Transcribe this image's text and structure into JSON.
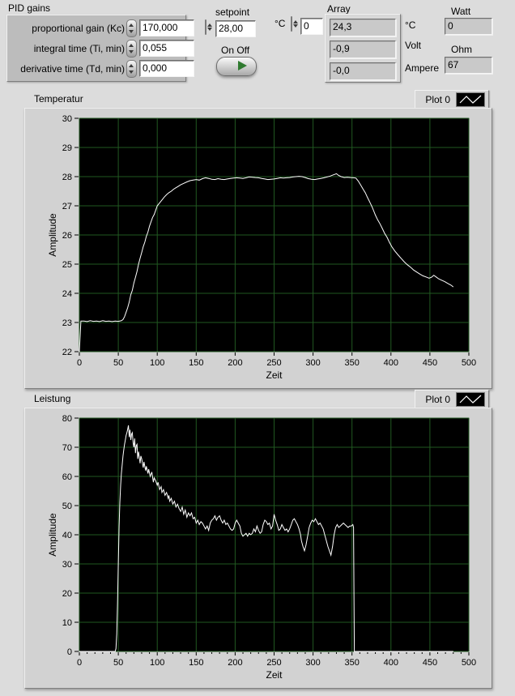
{
  "panel": {
    "pid": {
      "group_label": "PID gains",
      "rows": [
        {
          "label": "proportional gain (Kc)",
          "value": "170,000"
        },
        {
          "label": "integral time (Ti, min)",
          "value": "0,055"
        },
        {
          "label": "derivative time (Td, min)",
          "value": "0,000"
        }
      ]
    },
    "setpoint": {
      "label": "setpoint",
      "value": "28,00"
    },
    "onoff_label": "On Off",
    "celsius_control": {
      "label": "°C",
      "value": "0"
    },
    "array": {
      "label": "Array",
      "values": [
        "24,3",
        "-0,9",
        "-0,0"
      ]
    },
    "unit_labels": {
      "c": "°C",
      "volt": "Volt",
      "ampere": "Ampere"
    },
    "watt": {
      "label": "Watt",
      "value": "0"
    },
    "ohm": {
      "label": "Ohm",
      "value": "67"
    }
  },
  "chart_data": [
    {
      "type": "line",
      "title": "Temperatur",
      "legend": "Plot 0",
      "xlabel": "Zeit",
      "ylabel": "Amplitude",
      "xlim": [
        0,
        500
      ],
      "ylim": [
        22,
        30
      ],
      "xticks": [
        0,
        50,
        100,
        150,
        200,
        250,
        300,
        350,
        400,
        450,
        500
      ],
      "yticks": [
        22,
        23,
        24,
        25,
        26,
        27,
        28,
        29,
        30
      ],
      "x_minor_step": null,
      "grid": true,
      "legend_position": "top-right",
      "bg_color": "#000000",
      "grid_color": "#215821",
      "line_color": "#ffffff",
      "points": [
        [
          0,
          22.0
        ],
        [
          2,
          23.05
        ],
        [
          6,
          23.05
        ],
        [
          10,
          23.03
        ],
        [
          14,
          23.06
        ],
        [
          18,
          23.04
        ],
        [
          22,
          23.05
        ],
        [
          26,
          23.03
        ],
        [
          30,
          23.06
        ],
        [
          34,
          23.04
        ],
        [
          38,
          23.05
        ],
        [
          42,
          23.03
        ],
        [
          46,
          23.05
        ],
        [
          50,
          23.04
        ],
        [
          54,
          23.06
        ],
        [
          56,
          23.1
        ],
        [
          58,
          23.2
        ],
        [
          60,
          23.35
        ],
        [
          62,
          23.5
        ],
        [
          64,
          23.7
        ],
        [
          66,
          23.95
        ],
        [
          68,
          24.1
        ],
        [
          70,
          24.35
        ],
        [
          72,
          24.55
        ],
        [
          74,
          24.75
        ],
        [
          76,
          25.0
        ],
        [
          78,
          25.2
        ],
        [
          80,
          25.4
        ],
        [
          82,
          25.6
        ],
        [
          84,
          25.75
        ],
        [
          86,
          25.95
        ],
        [
          88,
          26.1
        ],
        [
          90,
          26.3
        ],
        [
          92,
          26.45
        ],
        [
          94,
          26.6
        ],
        [
          96,
          26.7
        ],
        [
          98,
          26.85
        ],
        [
          100,
          27.0
        ],
        [
          103,
          27.1
        ],
        [
          106,
          27.2
        ],
        [
          109,
          27.3
        ],
        [
          112,
          27.38
        ],
        [
          115,
          27.45
        ],
        [
          118,
          27.5
        ],
        [
          121,
          27.57
        ],
        [
          124,
          27.62
        ],
        [
          127,
          27.67
        ],
        [
          130,
          27.72
        ],
        [
          134,
          27.77
        ],
        [
          138,
          27.82
        ],
        [
          142,
          27.86
        ],
        [
          146,
          27.88
        ],
        [
          150,
          27.9
        ],
        [
          154,
          27.88
        ],
        [
          158,
          27.93
        ],
        [
          162,
          27.96
        ],
        [
          166,
          27.94
        ],
        [
          170,
          27.91
        ],
        [
          174,
          27.9
        ],
        [
          178,
          27.93
        ],
        [
          182,
          27.91
        ],
        [
          186,
          27.9
        ],
        [
          190,
          27.92
        ],
        [
          194,
          27.94
        ],
        [
          198,
          27.95
        ],
        [
          202,
          27.96
        ],
        [
          206,
          27.95
        ],
        [
          210,
          27.94
        ],
        [
          214,
          27.96
        ],
        [
          218,
          27.99
        ],
        [
          222,
          27.98
        ],
        [
          226,
          27.97
        ],
        [
          230,
          27.96
        ],
        [
          234,
          27.94
        ],
        [
          238,
          27.92
        ],
        [
          242,
          27.9
        ],
        [
          246,
          27.91
        ],
        [
          250,
          27.92
        ],
        [
          254,
          27.94
        ],
        [
          258,
          27.96
        ],
        [
          262,
          27.95
        ],
        [
          266,
          27.96
        ],
        [
          270,
          27.97
        ],
        [
          274,
          27.99
        ],
        [
          278,
          28.0
        ],
        [
          282,
          28.01
        ],
        [
          286,
          28.0
        ],
        [
          290,
          27.97
        ],
        [
          294,
          27.93
        ],
        [
          298,
          27.91
        ],
        [
          302,
          27.9
        ],
        [
          306,
          27.92
        ],
        [
          310,
          27.94
        ],
        [
          314,
          27.96
        ],
        [
          318,
          27.99
        ],
        [
          322,
          28.02
        ],
        [
          326,
          28.06
        ],
        [
          330,
          28.1
        ],
        [
          333,
          28.04
        ],
        [
          336,
          28.0
        ],
        [
          340,
          27.97
        ],
        [
          344,
          27.98
        ],
        [
          348,
          27.97
        ],
        [
          352,
          27.96
        ],
        [
          355,
          27.95
        ],
        [
          358,
          27.85
        ],
        [
          361,
          27.72
        ],
        [
          364,
          27.58
        ],
        [
          367,
          27.45
        ],
        [
          370,
          27.28
        ],
        [
          373,
          27.12
        ],
        [
          376,
          26.95
        ],
        [
          378,
          26.82
        ],
        [
          380,
          26.68
        ],
        [
          383,
          26.52
        ],
        [
          386,
          26.38
        ],
        [
          389,
          26.22
        ],
        [
          392,
          26.05
        ],
        [
          395,
          25.92
        ],
        [
          398,
          25.75
        ],
        [
          401,
          25.6
        ],
        [
          405,
          25.45
        ],
        [
          409,
          25.32
        ],
        [
          413,
          25.2
        ],
        [
          417,
          25.08
        ],
        [
          421,
          24.98
        ],
        [
          425,
          24.9
        ],
        [
          429,
          24.8
        ],
        [
          433,
          24.73
        ],
        [
          437,
          24.66
        ],
        [
          441,
          24.6
        ],
        [
          445,
          24.56
        ],
        [
          449,
          24.52
        ],
        [
          452,
          24.55
        ],
        [
          455,
          24.62
        ],
        [
          458,
          24.56
        ],
        [
          461,
          24.5
        ],
        [
          465,
          24.45
        ],
        [
          469,
          24.4
        ],
        [
          473,
          24.34
        ],
        [
          477,
          24.28
        ],
        [
          480,
          24.22
        ]
      ]
    },
    {
      "type": "line",
      "title": "Leistung",
      "legend": "Plot 0",
      "xlabel": "Zeit",
      "ylabel": "Amplitude",
      "xlim": [
        0,
        500
      ],
      "ylim": [
        0,
        80
      ],
      "xticks": [
        0,
        50,
        100,
        150,
        200,
        250,
        300,
        350,
        400,
        450,
        500
      ],
      "yticks": [
        0,
        10,
        20,
        30,
        40,
        50,
        60,
        70,
        80
      ],
      "x_minor_step": 10,
      "grid": true,
      "legend_position": "top-right",
      "bg_color": "#000000",
      "grid_color": "#215821",
      "line_color": "#ffffff",
      "points": [
        [
          0,
          0
        ],
        [
          46,
          0
        ],
        [
          47,
          1
        ],
        [
          48,
          6
        ],
        [
          49,
          16
        ],
        [
          50,
          30
        ],
        [
          51,
          43
        ],
        [
          52,
          51
        ],
        [
          53,
          57
        ],
        [
          54,
          61
        ],
        [
          55,
          64
        ],
        [
          56,
          67
        ],
        [
          57,
          69
        ],
        [
          58,
          71
        ],
        [
          59,
          72.5
        ],
        [
          60,
          74
        ],
        [
          61,
          75
        ],
        [
          62,
          76
        ],
        [
          63,
          77.5
        ],
        [
          64,
          73.5
        ],
        [
          65,
          76
        ],
        [
          66,
          72.5
        ],
        [
          67,
          74.5
        ],
        [
          68,
          75
        ],
        [
          69,
          71.5
        ],
        [
          70,
          70
        ],
        [
          71,
          73
        ],
        [
          72,
          68
        ],
        [
          73,
          70.5
        ],
        [
          74,
          71
        ],
        [
          75,
          66
        ],
        [
          76,
          68.5
        ],
        [
          77,
          66.5
        ],
        [
          78,
          64.5
        ],
        [
          79,
          67
        ],
        [
          80,
          66
        ],
        [
          82,
          63
        ],
        [
          83,
          65
        ],
        [
          85,
          62
        ],
        [
          86,
          63.5
        ],
        [
          88,
          61
        ],
        [
          89,
          62.5
        ],
        [
          91,
          60
        ],
        [
          93,
          61.5
        ],
        [
          95,
          58
        ],
        [
          96,
          59.5
        ],
        [
          98,
          58.5
        ],
        [
          100,
          57
        ],
        [
          101,
          58
        ],
        [
          103,
          55.5
        ],
        [
          105,
          56.5
        ],
        [
          106,
          54.5
        ],
        [
          108,
          55.5
        ],
        [
          110,
          53.5
        ],
        [
          112,
          54.5
        ],
        [
          114,
          52.5
        ],
        [
          115,
          53.5
        ],
        [
          116,
          51.5
        ],
        [
          118,
          52.5
        ],
        [
          120,
          50.5
        ],
        [
          122,
          51.5
        ],
        [
          124,
          49.5
        ],
        [
          126,
          50.5
        ],
        [
          128,
          49
        ],
        [
          130,
          48
        ],
        [
          132,
          49.5
        ],
        [
          134,
          47
        ],
        [
          136,
          48.5
        ],
        [
          138,
          46
        ],
        [
          140,
          47.5
        ],
        [
          142,
          46.5
        ],
        [
          144,
          47.5
        ],
        [
          146,
          45.5
        ],
        [
          148,
          46
        ],
        [
          150,
          44
        ],
        [
          152,
          45
        ],
        [
          154,
          43.5
        ],
        [
          156,
          44.5
        ],
        [
          158,
          44
        ],
        [
          160,
          43
        ],
        [
          162,
          42
        ],
        [
          164,
          43
        ],
        [
          166,
          41.5
        ],
        [
          168,
          44
        ],
        [
          170,
          45
        ],
        [
          172,
          45.5
        ],
        [
          174,
          46.5
        ],
        [
          176,
          45
        ],
        [
          178,
          46
        ],
        [
          180,
          46.5
        ],
        [
          182,
          45
        ],
        [
          184,
          44
        ],
        [
          186,
          45
        ],
        [
          188,
          43.5
        ],
        [
          190,
          44
        ],
        [
          192,
          43
        ],
        [
          194,
          42
        ],
        [
          196,
          41.5
        ],
        [
          198,
          42
        ],
        [
          200,
          44
        ],
        [
          202,
          45
        ],
        [
          204,
          44
        ],
        [
          206,
          43
        ],
        [
          208,
          40.5
        ],
        [
          210,
          39.5
        ],
        [
          212,
          40
        ],
        [
          214,
          40.5
        ],
        [
          216,
          39.5
        ],
        [
          218,
          40.5
        ],
        [
          220,
          40
        ],
        [
          222,
          40.5
        ],
        [
          224,
          42
        ],
        [
          226,
          41
        ],
        [
          228,
          43
        ],
        [
          230,
          41.5
        ],
        [
          232,
          40.5
        ],
        [
          234,
          41
        ],
        [
          236,
          43.5
        ],
        [
          238,
          45
        ],
        [
          240,
          44.5
        ],
        [
          242,
          43.5
        ],
        [
          244,
          44
        ],
        [
          246,
          42
        ],
        [
          248,
          43
        ],
        [
          250,
          47
        ],
        [
          252,
          45
        ],
        [
          254,
          43.5
        ],
        [
          256,
          41.5
        ],
        [
          258,
          42
        ],
        [
          260,
          43.5
        ],
        [
          262,
          42.5
        ],
        [
          264,
          41.5
        ],
        [
          266,
          42
        ],
        [
          268,
          41
        ],
        [
          270,
          42
        ],
        [
          272,
          43.5
        ],
        [
          274,
          45
        ],
        [
          276,
          45.5
        ],
        [
          278,
          44.5
        ],
        [
          280,
          43.5
        ],
        [
          282,
          42
        ],
        [
          284,
          40
        ],
        [
          285,
          38
        ],
        [
          287,
          36
        ],
        [
          289,
          34.5
        ],
        [
          291,
          36.5
        ],
        [
          293,
          39.5
        ],
        [
          295,
          42.5
        ],
        [
          297,
          44
        ],
        [
          299,
          45
        ],
        [
          301,
          44.5
        ],
        [
          303,
          45.5
        ],
        [
          305,
          44.5
        ],
        [
          307,
          43.5
        ],
        [
          309,
          44
        ],
        [
          311,
          43
        ],
        [
          313,
          42
        ],
        [
          315,
          40
        ],
        [
          317,
          38
        ],
        [
          319,
          36
        ],
        [
          321,
          34.5
        ],
        [
          323,
          33
        ],
        [
          325,
          36
        ],
        [
          327,
          40
        ],
        [
          329,
          42.5
        ],
        [
          331,
          43.5
        ],
        [
          333,
          42.5
        ],
        [
          335,
          43
        ],
        [
          337,
          43.5
        ],
        [
          339,
          44
        ],
        [
          341,
          43.5
        ],
        [
          343,
          43
        ],
        [
          345,
          42.5
        ],
        [
          347,
          43
        ],
        [
          349,
          43
        ],
        [
          351,
          43.5
        ],
        [
          352,
          42.5
        ],
        [
          353,
          0
        ],
        [
          480,
          0
        ]
      ]
    }
  ]
}
